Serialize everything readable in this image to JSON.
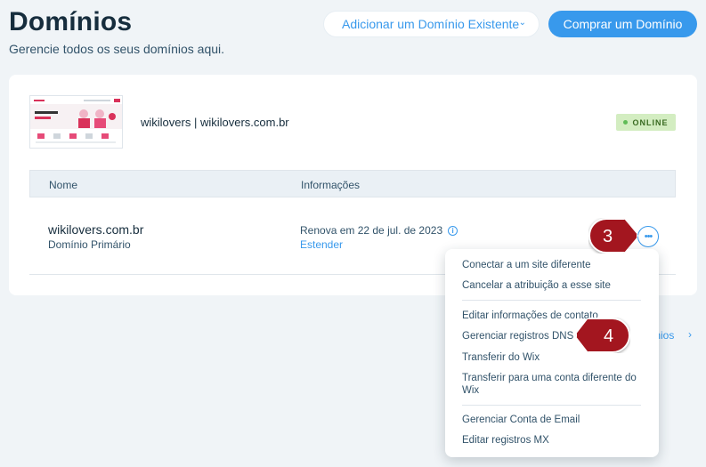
{
  "header": {
    "title": "Domínios",
    "subtitle": "Gerencie todos os seus domínios aqui.",
    "add_existing_label": "Adicionar um Domínio Existente",
    "buy_label": "Comprar um Domínio"
  },
  "site": {
    "name": "wikilovers | wikilovers.com.br",
    "status": "ONLINE"
  },
  "table": {
    "columns": [
      "Nome",
      "Informações"
    ],
    "row": {
      "domain": "wikilovers.com.br",
      "type": "Domínio Primário",
      "renewal": "Renova em 22 de jul. de 2023",
      "extend_label": "Estender"
    }
  },
  "menu": {
    "items": [
      "Conectar a um site diferente",
      "Cancelar a atribuição a esse site",
      "Editar informações de contato",
      "Gerenciar registros DNS",
      "Transferir do Wix",
      "Transferir para uma conta diferente do Wix",
      "Gerenciar Conta de Email",
      "Editar registros MX"
    ]
  },
  "partial_link": "ínios",
  "callouts": {
    "step3": "3",
    "step4": "4"
  },
  "colors": {
    "accent": "#3899ec",
    "title": "#162d3d",
    "online_badge": "#d3edc1",
    "callout": "#a3161f"
  },
  "icons": {
    "dropdown": "chevron-down-icon",
    "info": "info-icon",
    "more": "more-horizontal-icon",
    "link_arrow": "chevron-right-icon"
  }
}
